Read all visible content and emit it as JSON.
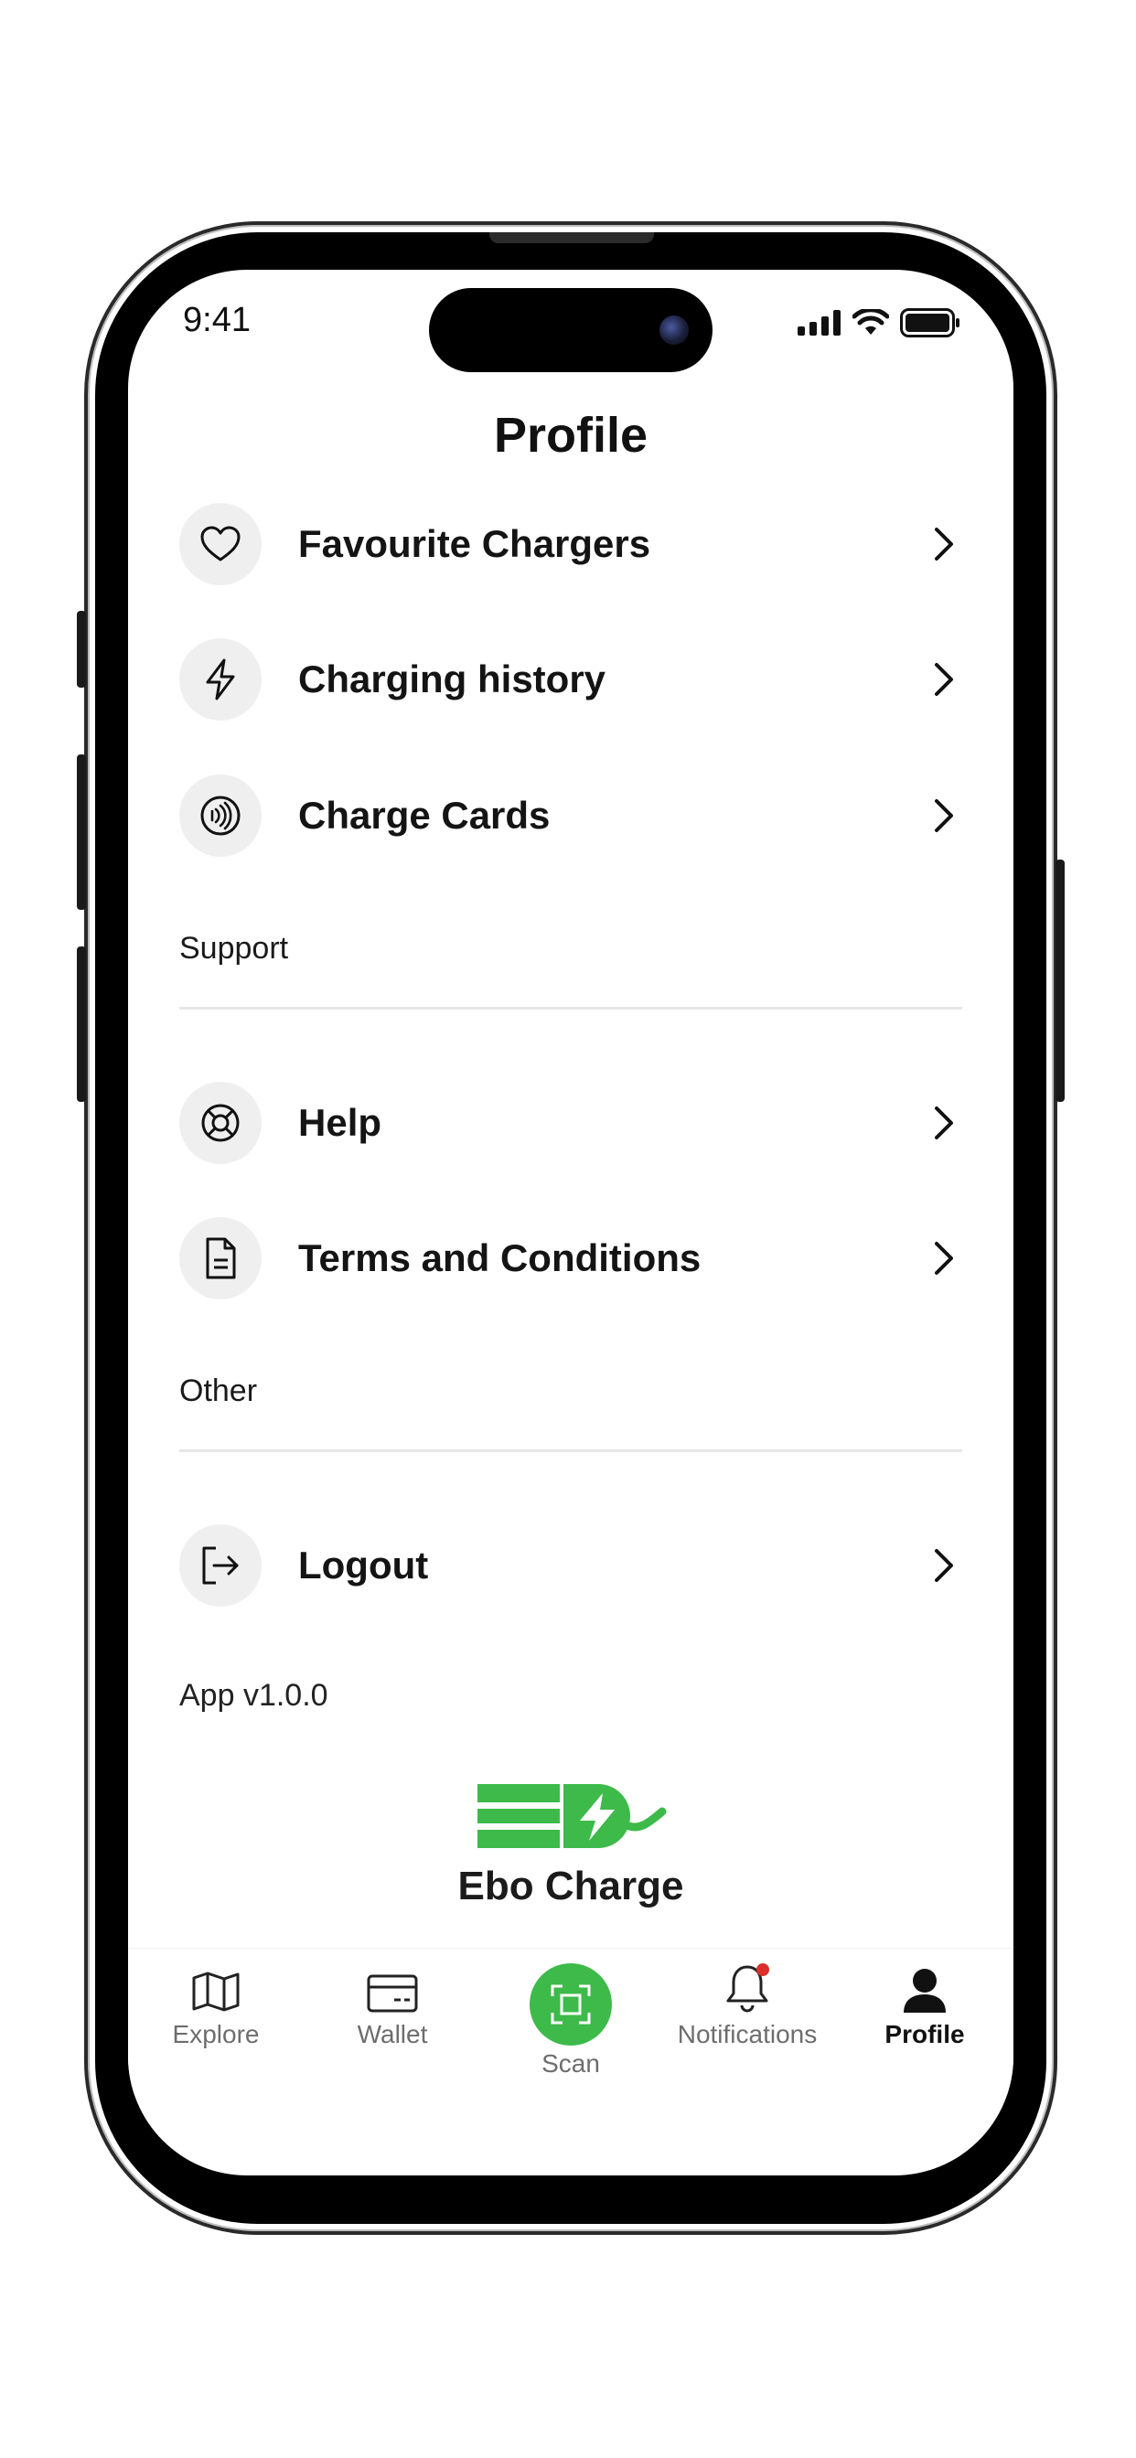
{
  "status": {
    "time": "9:41"
  },
  "page": {
    "title": "Profile"
  },
  "menu": {
    "account_items": [
      {
        "label": "Favourite Chargers",
        "icon": "heart-icon"
      },
      {
        "label": "Charging history",
        "icon": "lightning-icon"
      },
      {
        "label": "Charge Cards",
        "icon": "contactless-card-icon"
      }
    ],
    "support": {
      "heading": "Support",
      "items": [
        {
          "label": "Help",
          "icon": "lifebuoy-icon"
        },
        {
          "label": "Terms and Conditions",
          "icon": "document-icon"
        }
      ]
    },
    "other": {
      "heading": "Other",
      "items": [
        {
          "label": "Logout",
          "icon": "logout-icon"
        }
      ]
    }
  },
  "app_version": "App v1.0.0",
  "brand": {
    "name": "Ebo Charge",
    "color": "#3dba4a"
  },
  "tabbar": {
    "tabs": [
      {
        "label": "Explore",
        "icon": "map-icon"
      },
      {
        "label": "Wallet",
        "icon": "wallet-card-icon"
      },
      {
        "label": "Scan",
        "icon": "scan-icon"
      },
      {
        "label": "Notifications",
        "icon": "bell-icon",
        "badge": true
      },
      {
        "label": "Profile",
        "icon": "person-icon",
        "active": true
      }
    ]
  },
  "colors": {
    "accent": "#3dba4a",
    "badge": "#d9302c",
    "icon_bg": "#eeefee"
  }
}
